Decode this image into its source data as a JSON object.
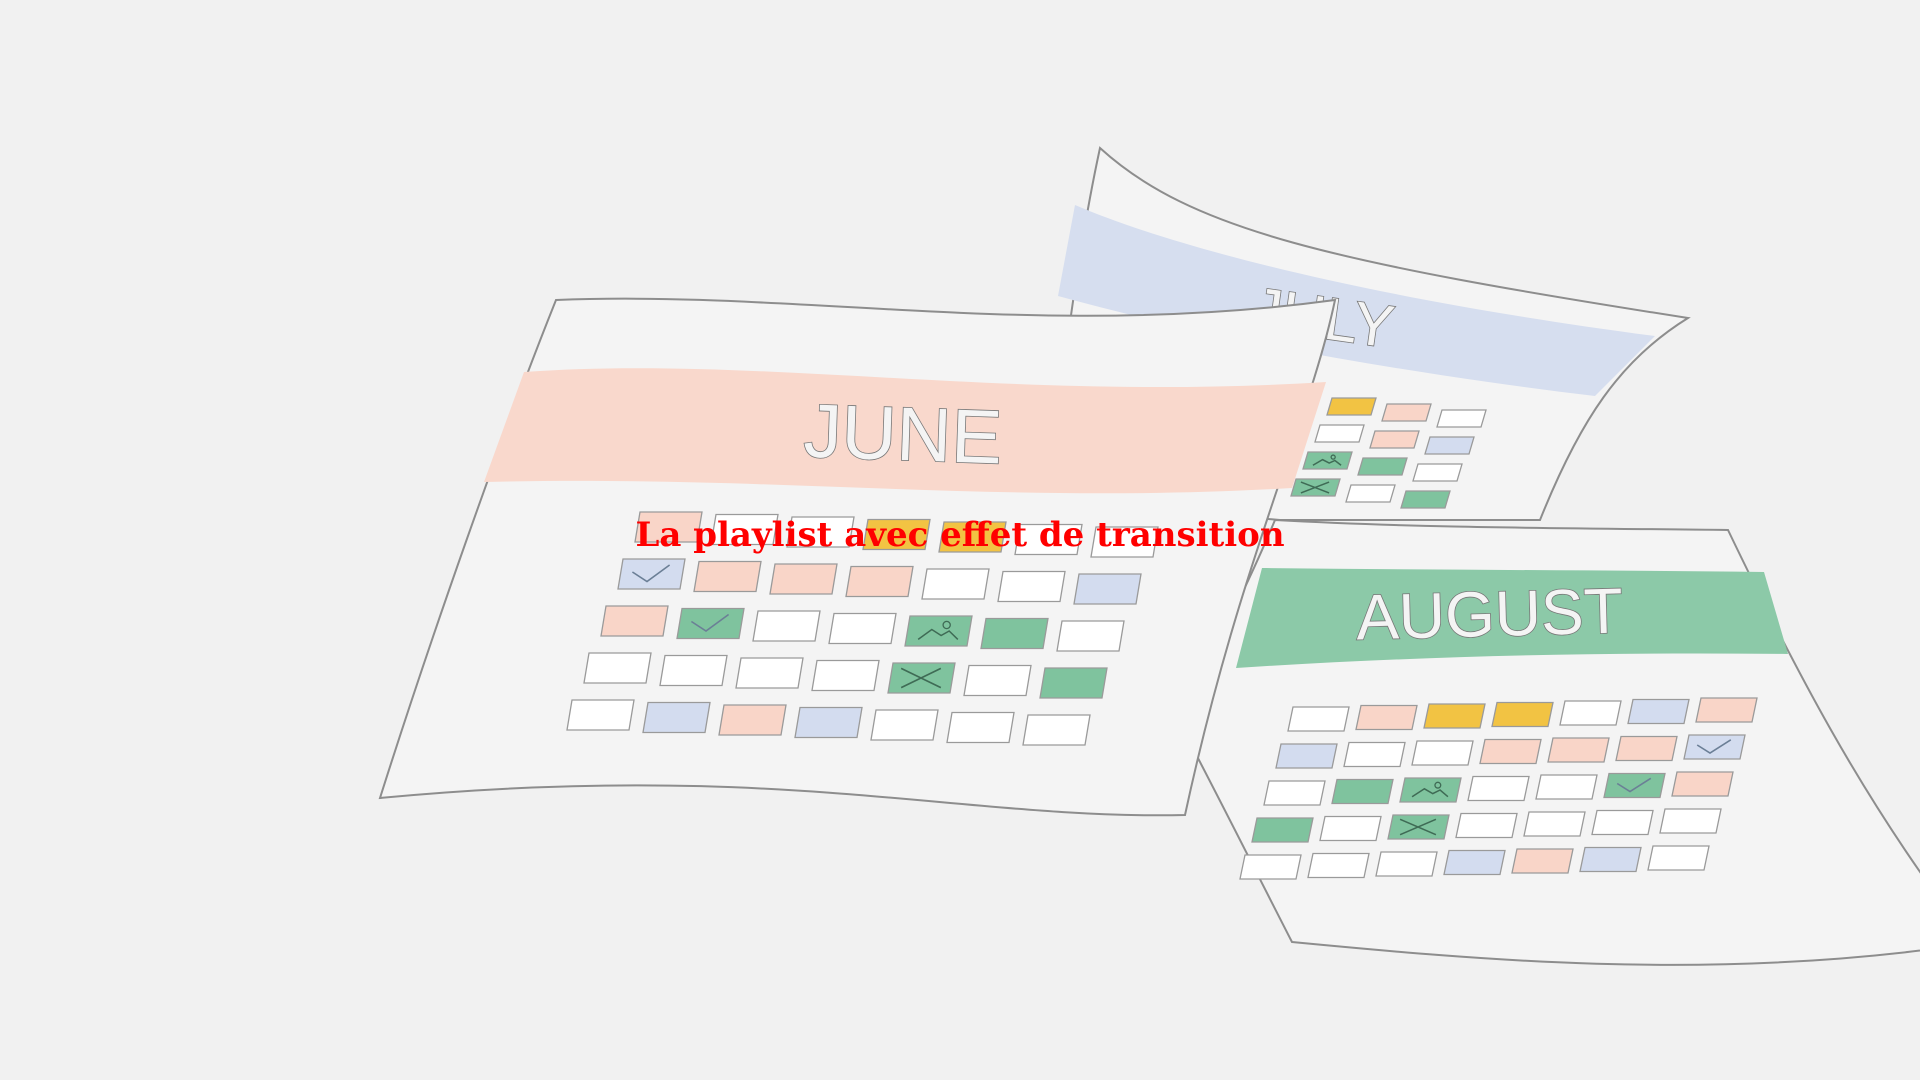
{
  "video": {
    "overlay_text": "La playlist avec effet de transition"
  },
  "calendars": [
    {
      "id": "june",
      "month": "JUNE",
      "band_color": "#f9d8cc",
      "marks": [
        [
          "peach",
          "white",
          "white",
          "yellow",
          "yellow",
          "white",
          "white"
        ],
        [
          "blue-check",
          "peach",
          "peach",
          "peach",
          "white",
          "white",
          "blue"
        ],
        [
          "peach",
          "green-check",
          "white",
          "white",
          "green-photo",
          "green",
          "white"
        ],
        [
          "white",
          "white",
          "white",
          "white",
          "green-cross",
          "white",
          "green"
        ],
        [
          "white",
          "blue",
          "peach",
          "blue",
          "white",
          "white",
          "white"
        ]
      ]
    },
    {
      "id": "july",
      "month": "JULY",
      "band_color": "#d6deef",
      "marks": [
        [
          "yellow",
          "peach",
          "white"
        ],
        [
          "white",
          "peach",
          "blue"
        ],
        [
          "green-photo",
          "green",
          "white"
        ],
        [
          "green-cross",
          "white",
          "green"
        ]
      ]
    },
    {
      "id": "august",
      "month": "AUGUST",
      "band_color": "#8cc9a8",
      "marks": [
        [
          "white",
          "peach",
          "yellow",
          "yellow",
          "white",
          "blue",
          "peach"
        ],
        [
          "blue",
          "white",
          "white",
          "peach",
          "peach",
          "peach",
          "blue-check"
        ],
        [
          "white",
          "green",
          "green-photo",
          "white",
          "white",
          "green-check",
          "peach"
        ],
        [
          "green",
          "white",
          "green-cross",
          "white",
          "white",
          "white",
          "white"
        ],
        [
          "white",
          "white",
          "white",
          "blue",
          "peach",
          "blue",
          "white"
        ]
      ]
    }
  ],
  "palette": {
    "peach": "#f9d5c8",
    "yellow": "#f2c343",
    "blue": "#d3dcef",
    "green": "#7fc39e",
    "white": "#ffffff",
    "outline": "#9a9a9a",
    "paper": "#f4f4f4",
    "text_red": "#ff0000"
  }
}
